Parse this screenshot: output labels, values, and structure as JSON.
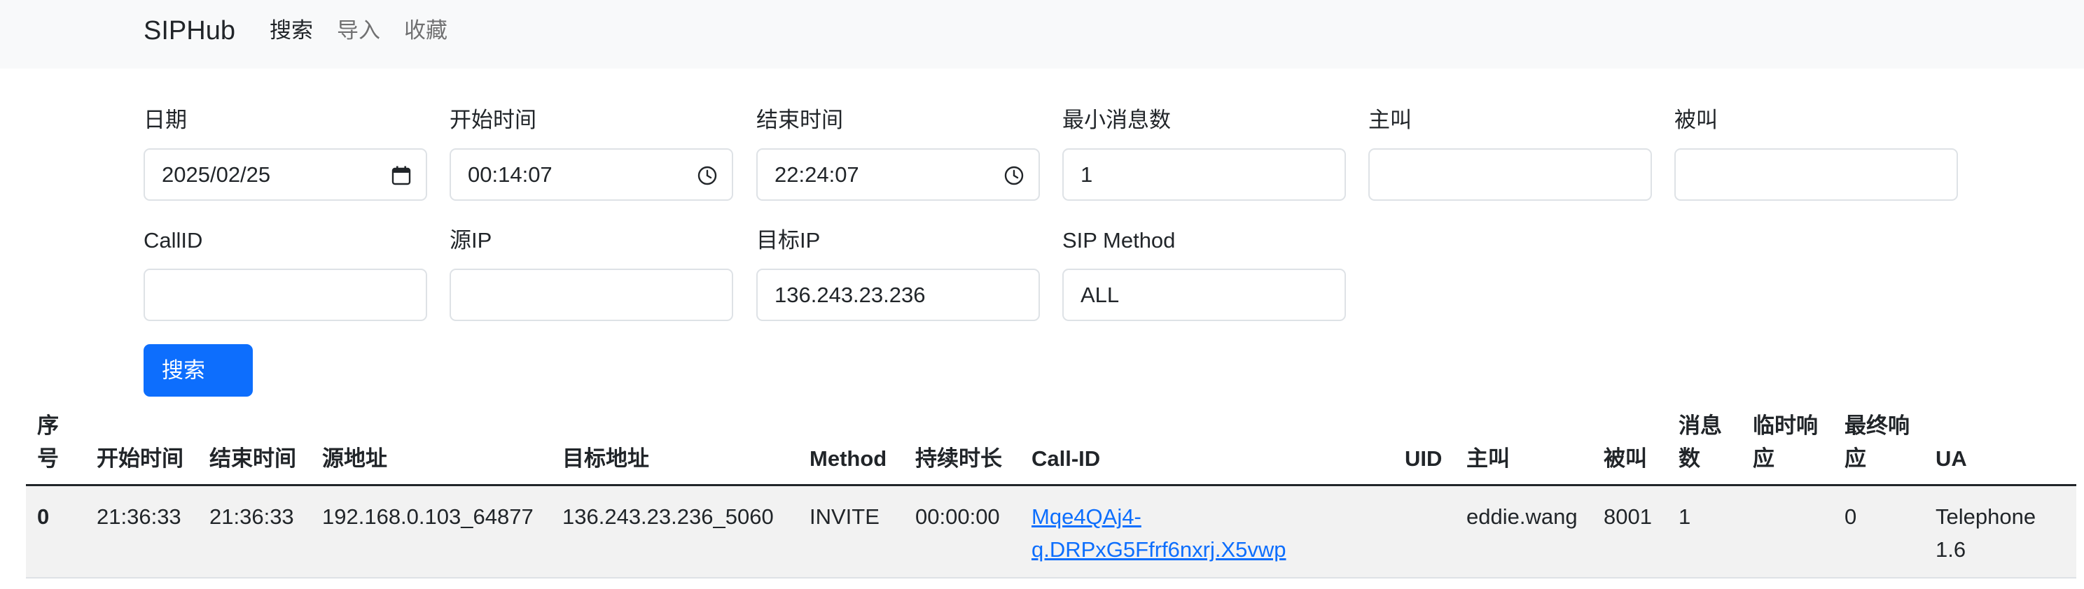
{
  "navbar": {
    "brand": "SIPHub",
    "links": [
      {
        "label": "搜索",
        "active": true
      },
      {
        "label": "导入",
        "active": false
      },
      {
        "label": "收藏",
        "active": false
      }
    ]
  },
  "form": {
    "date": {
      "label": "日期",
      "value": "2025/02/25"
    },
    "start_time": {
      "label": "开始时间",
      "value": "00:14:07"
    },
    "end_time": {
      "label": "结束时间",
      "value": "22:24:07"
    },
    "min_messages": {
      "label": "最小消息数",
      "value": "1"
    },
    "caller": {
      "label": "主叫",
      "value": ""
    },
    "callee": {
      "label": "被叫",
      "value": ""
    },
    "call_id": {
      "label": "CallID",
      "value": ""
    },
    "source_ip": {
      "label": "源IP",
      "value": ""
    },
    "target_ip": {
      "label": "目标IP",
      "value": "136.243.23.236"
    },
    "sip_method": {
      "label": "SIP Method",
      "value": "ALL"
    },
    "search_button": "搜索"
  },
  "table": {
    "headers": {
      "index": [
        "序",
        "号"
      ],
      "start_time": "开始时间",
      "end_time": "结束时间",
      "source_addr": "源地址",
      "target_addr": "目标地址",
      "method": "Method",
      "duration": "持续时长",
      "call_id": "Call-ID",
      "uid": "UID",
      "caller": "主叫",
      "callee": "被叫",
      "msg_count": [
        "消息",
        "数"
      ],
      "provisional": [
        "临时响",
        "应"
      ],
      "final": [
        "最终响",
        "应"
      ],
      "ua": "UA"
    },
    "rows": [
      {
        "index": "0",
        "start_time": "21:36:33",
        "end_time": "21:36:33",
        "source_addr": "192.168.0.103_64877",
        "target_addr": "136.243.23.236_5060",
        "method": "INVITE",
        "duration": "00:00:00",
        "call_id": [
          "Mqe4QAj4-",
          "q.DRPxG5Ffrf6nxrj.X5vwp"
        ],
        "uid": "",
        "caller": "eddie.wang",
        "callee": "8001",
        "msg_count": "1",
        "provisional": "",
        "final": "0",
        "ua": [
          "Telephone",
          "1.6"
        ]
      }
    ]
  },
  "colors": {
    "navbar_bg": "#f8f9fa",
    "primary": "#0d6efd",
    "row_stripe": "#f2f2f2"
  },
  "icons": {
    "date": "calendar-icon",
    "time": "clock-icon"
  }
}
